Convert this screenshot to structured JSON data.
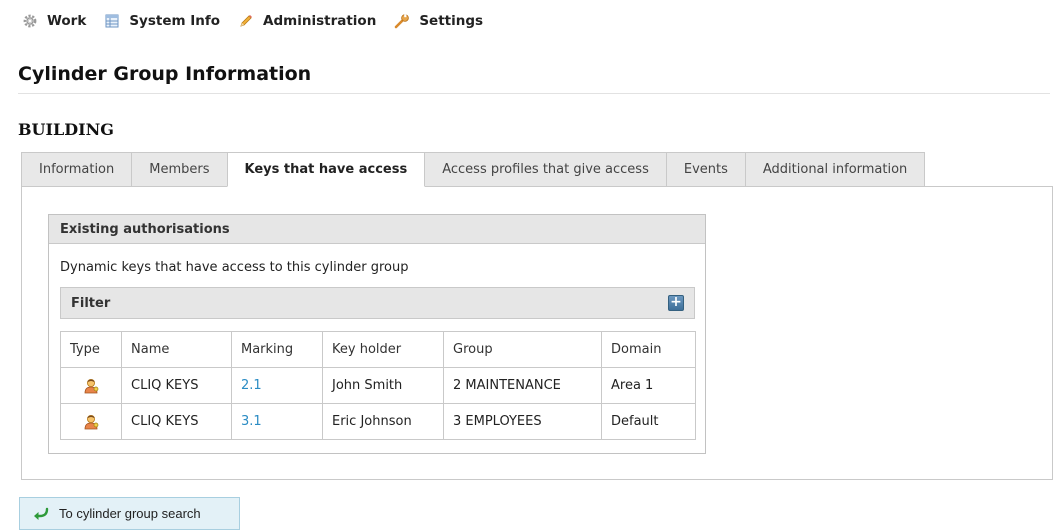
{
  "nav": {
    "items": [
      {
        "label": "Work",
        "icon": "gear-icon"
      },
      {
        "label": "System Info",
        "icon": "table-icon"
      },
      {
        "label": "Administration",
        "icon": "pencil-icon"
      },
      {
        "label": "Settings",
        "icon": "wrench-icon"
      }
    ]
  },
  "page": {
    "title": "Cylinder Group Information",
    "section": "BUILDING"
  },
  "tabs": [
    {
      "label": "Information",
      "active": false
    },
    {
      "label": "Members",
      "active": false
    },
    {
      "label": "Keys that have access",
      "active": true
    },
    {
      "label": "Access profiles that give access",
      "active": false
    },
    {
      "label": "Events",
      "active": false
    },
    {
      "label": "Additional information",
      "active": false
    }
  ],
  "authorisations": {
    "header": "Existing authorisations",
    "description": "Dynamic keys that have access to this cylinder group",
    "filter_label": "Filter",
    "filter_add_icon": "plus-icon",
    "columns": [
      "Type",
      "Name",
      "Marking",
      "Key holder",
      "Group",
      "Domain"
    ],
    "rows": [
      {
        "type_icon": "key-user-icon",
        "name": "CLIQ KEYS",
        "marking": "2.1",
        "key_holder": "John Smith",
        "group": "2 MAINTENANCE",
        "domain": "Area 1"
      },
      {
        "type_icon": "key-user-icon",
        "name": "CLIQ KEYS",
        "marking": "3.1",
        "key_holder": "Eric Johnson",
        "group": "3 EMPLOYEES",
        "domain": "Default"
      }
    ]
  },
  "back_button": {
    "label": "To cylinder group search",
    "icon": "back-arrow-icon"
  },
  "colors": {
    "link": "#2b8cc4",
    "tab_bg": "#e8e8e8",
    "border": "#c9c9c9",
    "back_button_bg": "#e3f1f7"
  }
}
